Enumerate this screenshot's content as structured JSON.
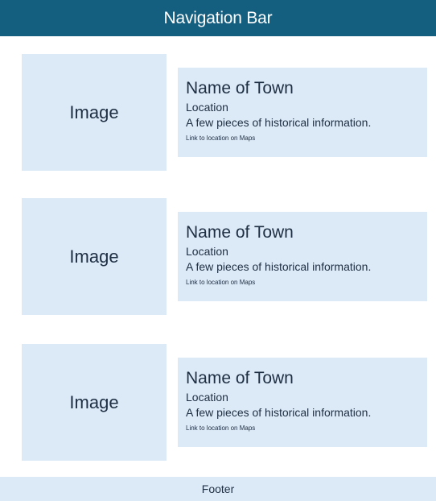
{
  "nav": {
    "title": "Navigation Bar"
  },
  "cards": [
    {
      "image_label": "Image",
      "name": "Name of Town",
      "location": "Location",
      "info": "A few pieces of historical information.",
      "link": "Link to location on Maps"
    },
    {
      "image_label": "Image",
      "name": "Name of Town",
      "location": "Location",
      "info": "A few pieces of historical information.",
      "link": "Link to location on Maps"
    },
    {
      "image_label": "Image",
      "name": "Name of Town",
      "location": "Location",
      "info": "A few pieces of historical information.",
      "link": "Link to location on Maps"
    }
  ],
  "footer": {
    "label": "Footer"
  },
  "colors": {
    "nav_background": "#145e80",
    "panel_background": "#dce9f6",
    "text": "#1e2f43"
  }
}
